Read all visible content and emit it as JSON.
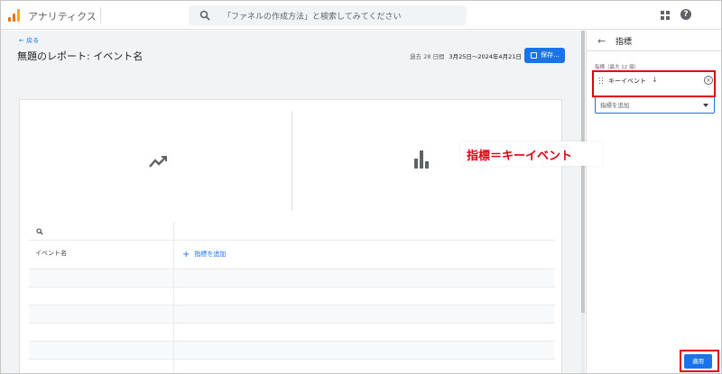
{
  "header": {
    "app_title": "アナリティクス",
    "search_placeholder": "「ファネルの作成方法」と検索してみてください",
    "logo_colors": [
      "#f9ab00",
      "#e37400",
      "#e37400"
    ]
  },
  "report": {
    "back_label": "← 戻る",
    "title": "無題のレポート: イベント名",
    "date_prefix": "過去 28 日間",
    "date_range": "3月25日～2024年4月21日",
    "save_label": "保存..."
  },
  "table": {
    "dimension_label": "イベント名",
    "add_metric_label": "指標を追加",
    "add_metric_icon": "plus-icon",
    "empty_rows": 6
  },
  "panel": {
    "title": "指標",
    "back_icon": "arrow-left-icon",
    "metric_count_label": "指標（最大 12 個）",
    "metric_chip_label": "キーイベント",
    "metric_chip_arrow": "↓",
    "add_metric_placeholder": "指標を追加",
    "apply_label": "適用"
  },
  "annotation": {
    "callout_text": "指標＝キーイベント",
    "highlight_color": "#e00012"
  },
  "colors": {
    "accent": "#1a73e8",
    "background": "#f1f3f4"
  }
}
